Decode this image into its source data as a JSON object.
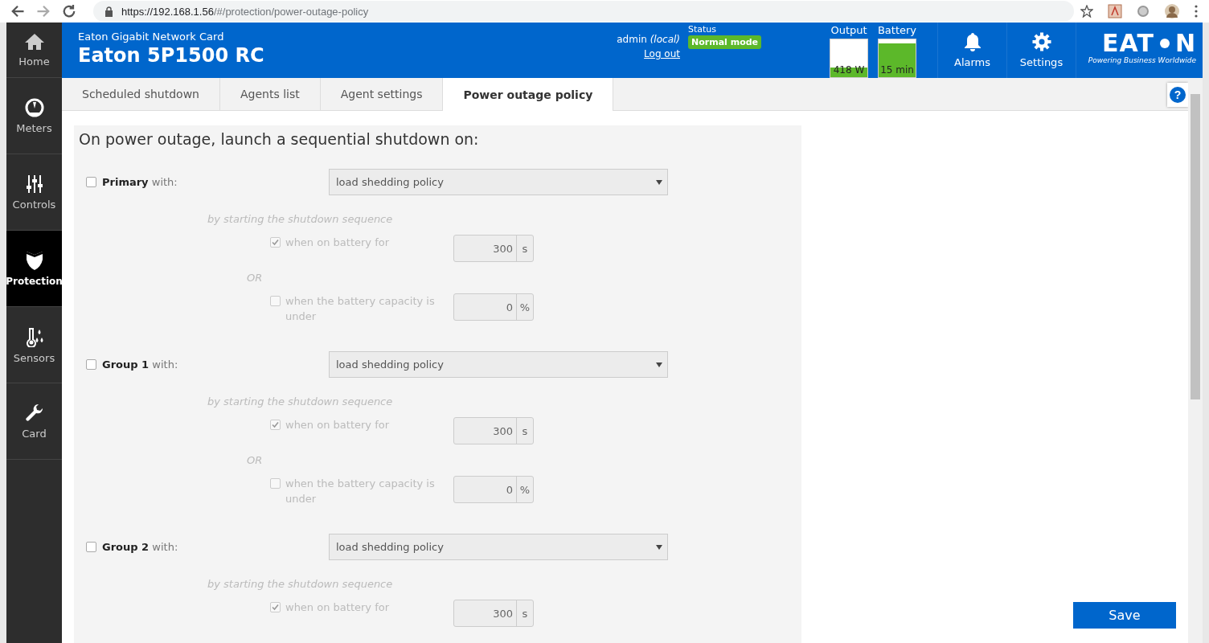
{
  "browser": {
    "url_host": "https://192.168.1.56",
    "url_path": "/#/protection/power-outage-policy"
  },
  "header": {
    "subtitle": "Eaton Gigabit Network Card",
    "title": "Eaton 5P1500 RC",
    "user": "admin *(local)*",
    "logout": "Log out",
    "status_label": "Status",
    "status": "Normal mode",
    "meters": [
      {
        "label": "Output",
        "reading": "418 W",
        "level": 0.25
      },
      {
        "label": "Battery",
        "reading": "15 min",
        "level": 0.9
      }
    ],
    "buttons": [
      {
        "kind": "bell",
        "label": "Alarms"
      },
      {
        "kind": "gear",
        "label": "Settings"
      }
    ],
    "logo": {
      "left": "EAT",
      "right": "N",
      "tagline": "Powering Business Worldwide"
    }
  },
  "sidebar": {
    "items": [
      {
        "kind": "home",
        "label": "Home",
        "selected": false
      },
      {
        "kind": "meters",
        "label": "Meters",
        "selected": false
      },
      {
        "kind": "controls",
        "label": "Controls",
        "selected": false
      },
      {
        "kind": "protection",
        "label": "Protection",
        "selected": true
      },
      {
        "kind": "sensors",
        "label": "Sensors",
        "selected": false
      },
      {
        "kind": "card",
        "label": "Card",
        "selected": false
      }
    ]
  },
  "tabs": [
    {
      "label": "Scheduled shutdown",
      "selected": false
    },
    {
      "label": "Agents list",
      "selected": false
    },
    {
      "label": "Agent settings",
      "selected": false
    },
    {
      "label": "Power outage policy",
      "selected": true
    }
  ],
  "help": "?",
  "heading": "On power outage, launch a sequential shutdown on:",
  "groups": [
    {
      "name": "Primary",
      "suffix": "with:",
      "checked": false,
      "policy": "load shedding policy",
      "sequence": "by starting the shutdown sequence",
      "battery": {
        "checked": true,
        "label": "when on battery for",
        "value": "300",
        "unit": "s"
      },
      "or": "OR",
      "capacity": {
        "checked": false,
        "label": "when the battery capacity is under",
        "value": "0",
        "unit": "%"
      }
    },
    {
      "name": "Group 1",
      "suffix": "with:",
      "checked": false,
      "policy": "load shedding policy",
      "sequence": "by starting the shutdown sequence",
      "battery": {
        "checked": true,
        "label": "when on battery for",
        "value": "300",
        "unit": "s"
      },
      "or": "OR",
      "capacity": {
        "checked": false,
        "label": "when the battery capacity is under",
        "value": "0",
        "unit": "%"
      }
    },
    {
      "name": "Group 2",
      "suffix": "with:",
      "checked": false,
      "policy": "load shedding policy",
      "sequence": "by starting the shutdown sequence",
      "battery": {
        "checked": true,
        "label": "when on battery for",
        "value": "300",
        "unit": "s"
      }
    }
  ],
  "save": "Save"
}
